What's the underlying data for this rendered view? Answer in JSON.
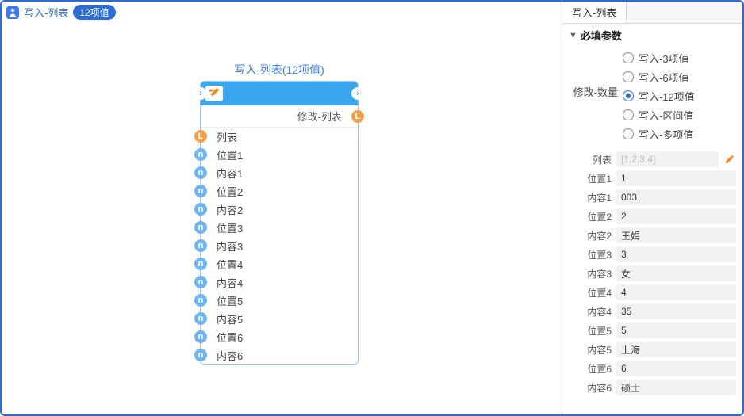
{
  "canvas": {
    "header": {
      "title": "写入-列表",
      "badge": "12项值"
    },
    "node": {
      "title": "写入-列表(12项值)",
      "sub_label": "修改-列表",
      "ports": [
        {
          "type": "L",
          "label": "列表"
        },
        {
          "type": "n",
          "label": "位置1"
        },
        {
          "type": "n",
          "label": "内容1"
        },
        {
          "type": "n",
          "label": "位置2"
        },
        {
          "type": "n",
          "label": "内容2"
        },
        {
          "type": "n",
          "label": "位置3"
        },
        {
          "type": "n",
          "label": "内容3"
        },
        {
          "type": "n",
          "label": "位置4"
        },
        {
          "type": "n",
          "label": "内容4"
        },
        {
          "type": "n",
          "label": "位置5"
        },
        {
          "type": "n",
          "label": "内容5"
        },
        {
          "type": "n",
          "label": "位置6"
        },
        {
          "type": "n",
          "label": "内容6"
        }
      ]
    }
  },
  "side": {
    "tab": "写入-列表",
    "section": "必填参数",
    "radio": {
      "label": "修改-数量",
      "options": [
        {
          "label": "写入-3项值",
          "selected": false
        },
        {
          "label": "写入-6项值",
          "selected": false
        },
        {
          "label": "写入-12项值",
          "selected": true
        },
        {
          "label": "写入-区间值",
          "selected": false
        },
        {
          "label": "写入-多项值",
          "selected": false
        }
      ]
    },
    "params": [
      {
        "label": "列表",
        "value": "",
        "placeholder": "[1,2,3,4]",
        "editable": true
      },
      {
        "label": "位置1",
        "value": "1"
      },
      {
        "label": "内容1",
        "value": "003"
      },
      {
        "label": "位置2",
        "value": "2"
      },
      {
        "label": "内容2",
        "value": "王娟"
      },
      {
        "label": "位置3",
        "value": "3"
      },
      {
        "label": "内容3",
        "value": "女"
      },
      {
        "label": "位置4",
        "value": "4"
      },
      {
        "label": "内容4",
        "value": "35"
      },
      {
        "label": "位置5",
        "value": "5"
      },
      {
        "label": "内容5",
        "value": "上海"
      },
      {
        "label": "位置6",
        "value": "6"
      },
      {
        "label": "内容6",
        "value": "硕士"
      }
    ]
  }
}
